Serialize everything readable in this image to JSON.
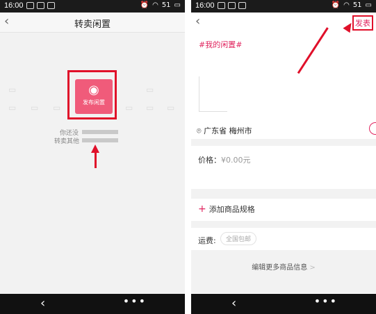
{
  "left": {
    "status": {
      "time": "16:00",
      "battery": "51"
    },
    "title": "转卖闲置",
    "publish_tile_label": "发布闲置",
    "hint_line1": "你还没",
    "hint_line2": "转卖其他"
  },
  "right": {
    "status": {
      "time": "16:00",
      "battery": "51"
    },
    "publish_label": "发表",
    "topic_tag": "#我的闲置#",
    "location": "广东省 梅州市",
    "price_label": "价格：",
    "price_value": "¥0.00元",
    "add_spec_label": "添加商品规格",
    "shipping_label": "运费:",
    "shipping_chip": "全国包邮",
    "edit_more_label": "编辑更多商品信息",
    "edit_more_chevron": ">"
  },
  "colors": {
    "accent": "#e0245e",
    "annotation_red": "#e0102a",
    "tile_pink": "#f05b7a"
  },
  "icons": {
    "back": "chevron-left-icon",
    "camera": "camera-icon",
    "location": "location-pin-icon",
    "plus": "plus-icon"
  }
}
